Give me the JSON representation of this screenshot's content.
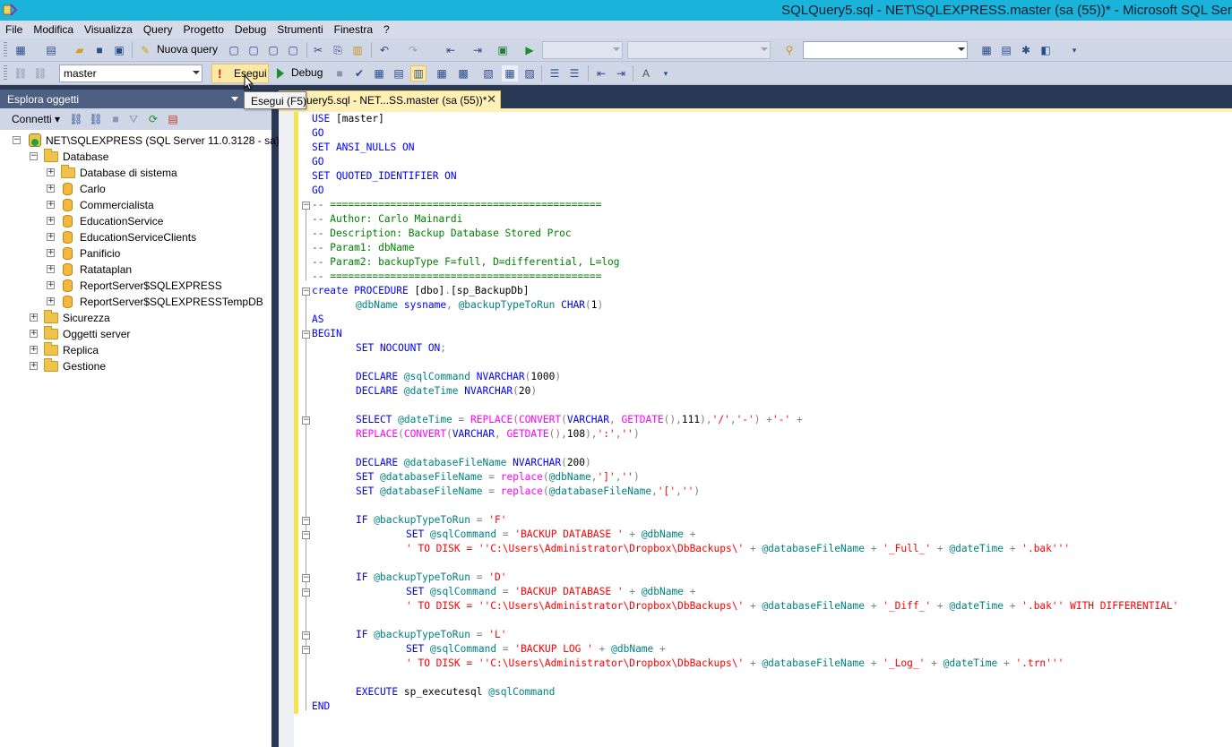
{
  "window": {
    "title": "SQLQuery5.sql - NET\\SQLEXPRESS.master (sa (55))* - Microsoft SQL Ser"
  },
  "menu": [
    "File",
    "Modifica",
    "Visualizza",
    "Query",
    "Progetto",
    "Debug",
    "Strumenti",
    "Finestra",
    "?"
  ],
  "toolbar": {
    "new_query_label": "Nuova query",
    "database_selected": "master",
    "execute_label": "Esegui",
    "debug_label": "Debug"
  },
  "tooltip": "Esegui (F5)",
  "object_explorer": {
    "title": "Esplora oggetti",
    "connect_label": "Connetti",
    "server": "NET\\SQLEXPRESS (SQL Server 11.0.3128 - sa)",
    "databases_folder": "Database",
    "system_db_folder": "Database di sistema",
    "databases": [
      "Carlo",
      "Commercialista",
      "EducationService",
      "EducationServiceClients",
      "Panificio",
      "Ratataplan",
      "ReportServer$SQLEXPRESS",
      "ReportServer$SQLEXPRESSTempDB"
    ],
    "folders": [
      "Sicurezza",
      "Oggetti server",
      "Replica",
      "Gestione"
    ]
  },
  "editor": {
    "tab_label": "uery5.sql - NET...SS.master (sa (55))*",
    "tab_close": "✕"
  },
  "icons": {
    "app": "ssms-app-icon",
    "execute": "exclamation-icon",
    "debug": "play-icon"
  }
}
